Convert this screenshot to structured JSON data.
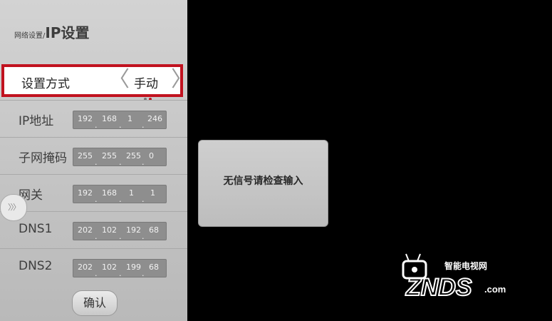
{
  "panel": {
    "breadcrumb": "网络设置/",
    "title": "IP设置",
    "method": {
      "label": "设置方式",
      "value": "手动",
      "left_arrow": "〈",
      "right_arrow": "〉"
    },
    "ip": {
      "label": "IP地址",
      "octets": [
        "192",
        "168",
        "1",
        "246"
      ]
    },
    "mask": {
      "label": "子网掩码",
      "octets": [
        "255",
        "255",
        "255",
        "0"
      ]
    },
    "gateway": {
      "label": "网关",
      "octets": [
        "192",
        "168",
        "1",
        "1"
      ]
    },
    "dns1": {
      "label": "DNS1",
      "octets": [
        "202",
        "102",
        "192",
        "68"
      ]
    },
    "dns2": {
      "label": "DNS2",
      "octets": [
        "202",
        "102",
        "199",
        "68"
      ]
    },
    "confirm": "确认",
    "expand": "〉〉〉"
  },
  "dialog": {
    "message": "无信号请检查输入"
  },
  "watermark": {
    "top": "智能电视网",
    "brand": "ZNDS",
    "suffix": ".com"
  },
  "colors": {
    "highlight": "#c1121f",
    "panel_bg": "#c8c8c8",
    "screen_bg": "#000000"
  }
}
